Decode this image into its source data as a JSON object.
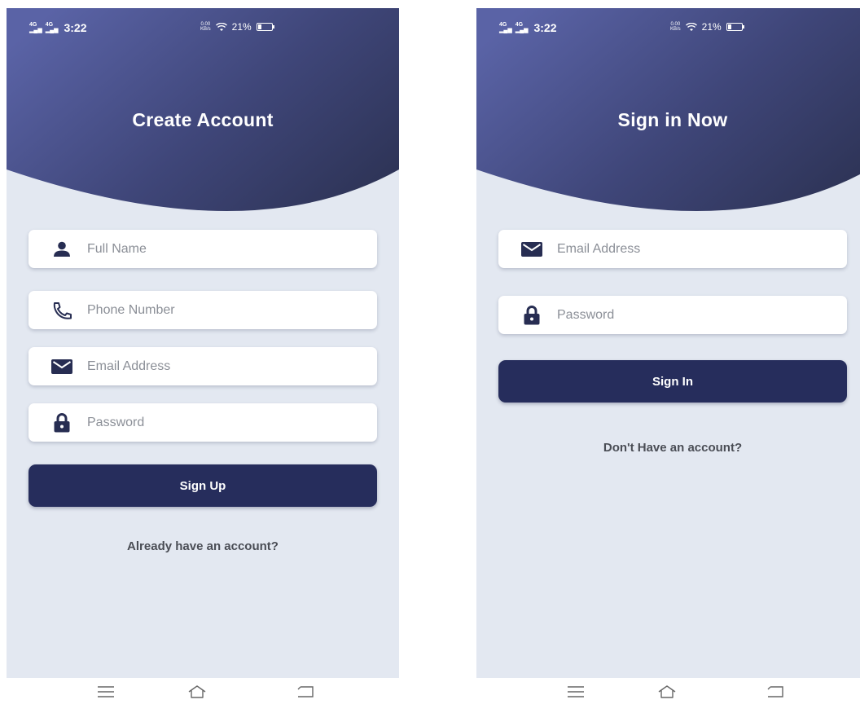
{
  "status_bar": {
    "signal_1": "4G",
    "signal_2": "4G",
    "time": "3:22",
    "speed_value": "0.00",
    "speed_unit": "KB/s",
    "battery": "21%"
  },
  "signup": {
    "title": "Create Account",
    "fields": [
      {
        "placeholder": "Full Name",
        "icon": "person-icon"
      },
      {
        "placeholder": "Phone Number",
        "icon": "phone-icon"
      },
      {
        "placeholder": "Email Address",
        "icon": "email-icon"
      },
      {
        "placeholder": "Password",
        "icon": "lock-icon"
      }
    ],
    "button_label": "Sign Up",
    "link_label": "Already have an account?"
  },
  "signin": {
    "title": "Sign in Now",
    "fields": [
      {
        "placeholder": "Email Address",
        "icon": "email-icon"
      },
      {
        "placeholder": "Password",
        "icon": "lock-icon"
      }
    ],
    "button_label": "Sign In",
    "link_label": "Don't Have an account?"
  },
  "nav": {
    "icons": [
      "menu-icon",
      "home-icon",
      "back-icon"
    ]
  },
  "colors": {
    "header_gradient_start": "#5a63a6",
    "header_gradient_end": "#2e3457",
    "background": "#e3e8f1",
    "button": "#262d5c",
    "icon": "#272d52"
  }
}
